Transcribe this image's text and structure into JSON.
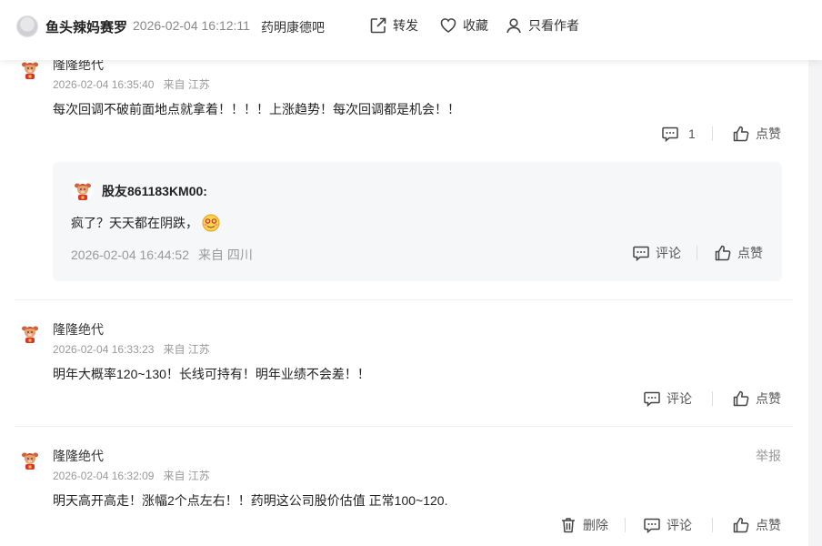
{
  "header": {
    "username": "鱼头辣妈赛罗",
    "time": "2026-02-04 16:12:11",
    "bar": "药明康德吧",
    "share_label": "转发",
    "favorite_label": "收藏",
    "author_only_label": "只看作者"
  },
  "comments": [
    {
      "name": "隆隆绝代",
      "time": "2026-02-04 16:35:40",
      "location": "来自 江苏",
      "text": "每次回调不破前面地点就拿着！！！！上涨趋势！每次回调都是机会！！",
      "reply_count": "1",
      "like_label": "点赞",
      "reply": {
        "name": "股友861183KM00:",
        "text": "疯了？天天都在阴跌，",
        "time": "2026-02-04 16:44:52",
        "location": "来自 四川",
        "comment_label": "评论",
        "like_label": "点赞"
      }
    },
    {
      "name": "隆隆绝代",
      "time": "2026-02-04 16:33:23",
      "location": "来自 江苏",
      "text": "明年大概率120~130！长线可持有！明年业绩不会差！！",
      "comment_label": "评论",
      "like_label": "点赞"
    },
    {
      "name": "隆隆绝代",
      "time": "2026-02-04 16:32:09",
      "location": "来自 江苏",
      "text": "明天高开高走！涨幅2个点左右！！药明这公司股价估值 正常100~120.",
      "report_label": "举报",
      "delete_label": "删除",
      "comment_label": "评论",
      "like_label": "点赞"
    }
  ]
}
